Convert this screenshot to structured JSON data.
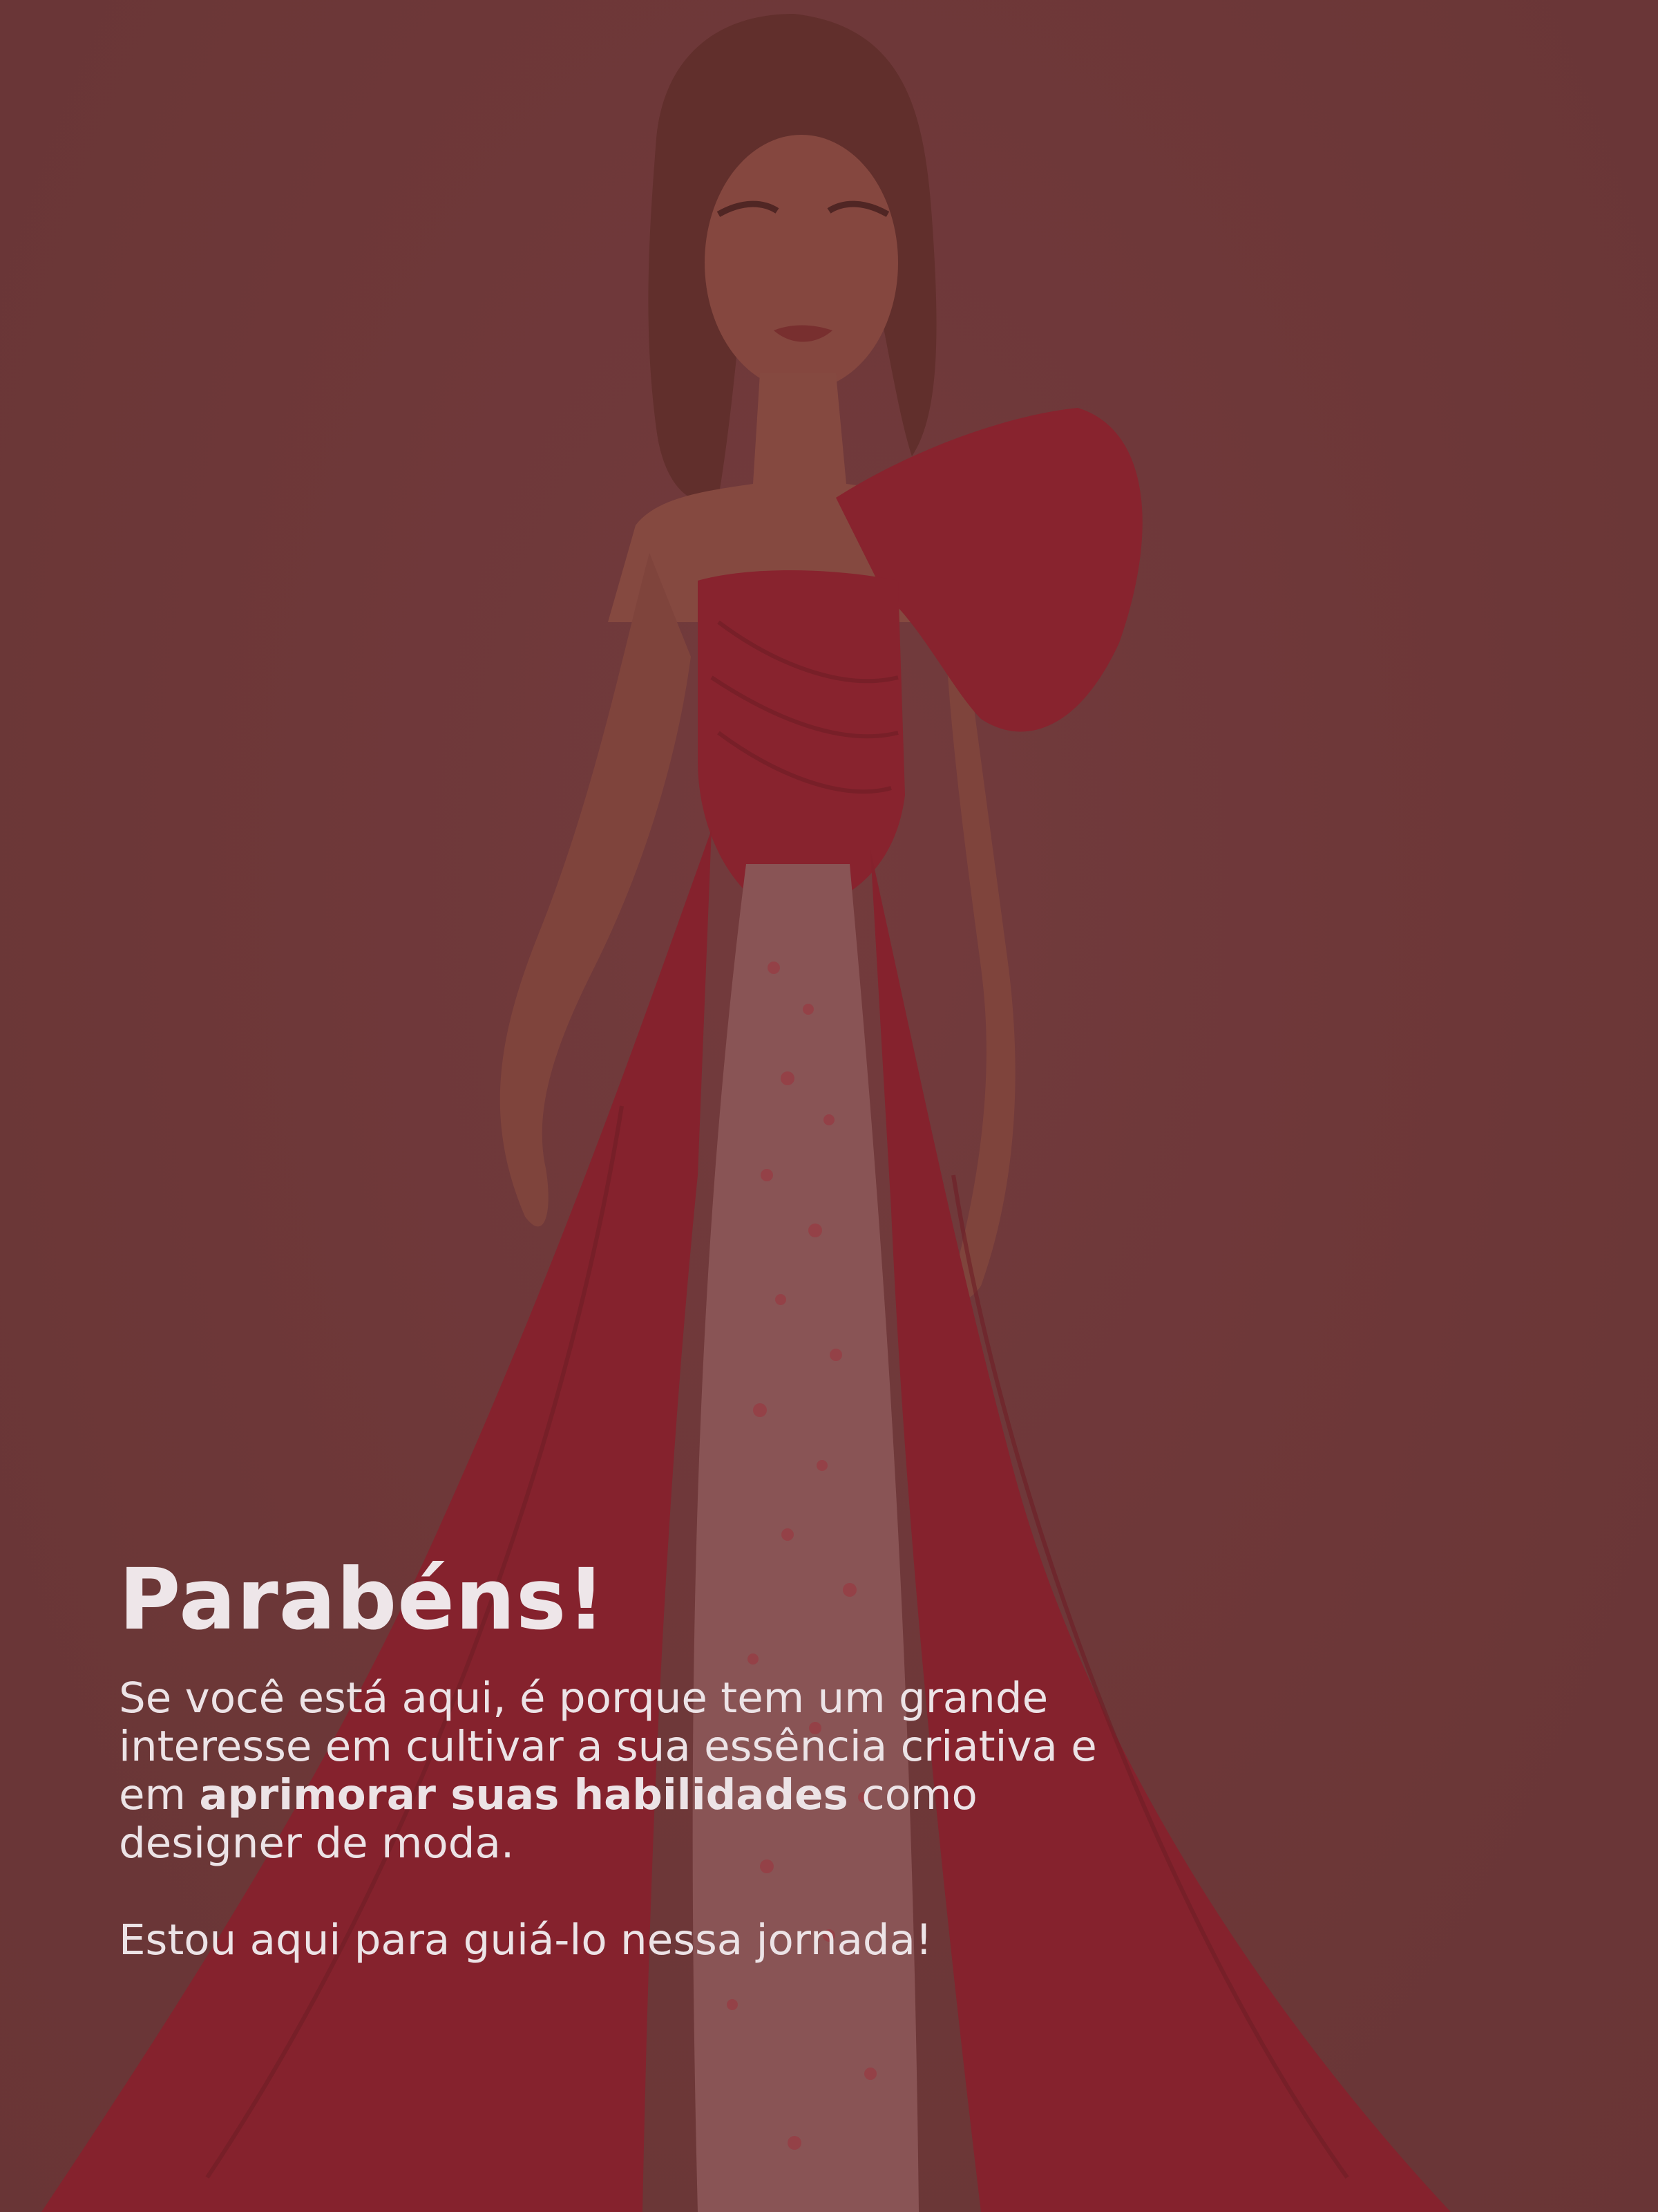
{
  "heading": "Parabéns!",
  "intro": {
    "part1": "Se você está aqui, é porque tem um grande interesse em cultivar a sua essência criativa e em ",
    "bold": "aprimorar suas habilidades",
    "part2": " como designer de moda."
  },
  "closing": "Estou aqui para guiá-lo nessa jornada!",
  "colors": {
    "background": "#6d3839",
    "dress": "#8e1f2c",
    "text": "#ece3e6"
  }
}
